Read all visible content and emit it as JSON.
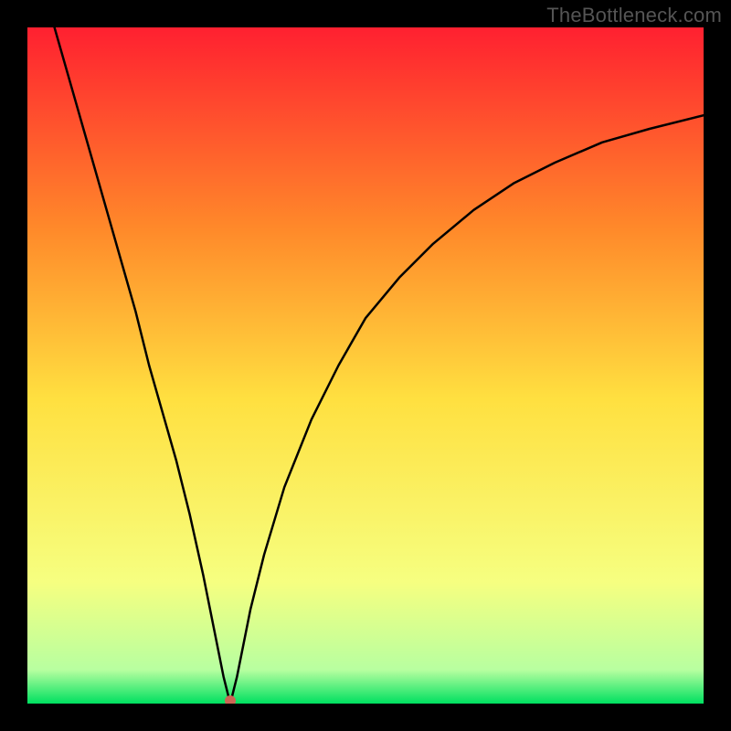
{
  "watermark": {
    "text": "TheBottleneck.com"
  },
  "chart_data": {
    "type": "line",
    "title": "",
    "xlabel": "",
    "ylabel": "",
    "xlim": [
      0,
      100
    ],
    "ylim": [
      0,
      100
    ],
    "grid": false,
    "background_gradient": {
      "top": "#ff2030",
      "upper_mid": "#ff8a2a",
      "mid": "#ffe040",
      "lower_mid": "#f6ff80",
      "green_band": "#00e060",
      "bottom": "#00e060"
    },
    "minimum_marker": {
      "x": 30,
      "y": 0,
      "color": "#cc6655"
    },
    "series": [
      {
        "name": "bottleneck-curve",
        "color": "#000000",
        "x": [
          4,
          6,
          8,
          10,
          12,
          14,
          16,
          18,
          20,
          22,
          24,
          26,
          27,
          28,
          29,
          30,
          31,
          32,
          33,
          35,
          38,
          42,
          46,
          50,
          55,
          60,
          66,
          72,
          78,
          85,
          92,
          100
        ],
        "values": [
          100,
          93,
          86,
          79,
          72,
          65,
          58,
          50,
          43,
          36,
          28,
          19,
          14,
          9,
          4,
          0,
          4,
          9,
          14,
          22,
          32,
          42,
          50,
          57,
          63,
          68,
          73,
          77,
          80,
          83,
          85,
          87
        ]
      }
    ]
  }
}
